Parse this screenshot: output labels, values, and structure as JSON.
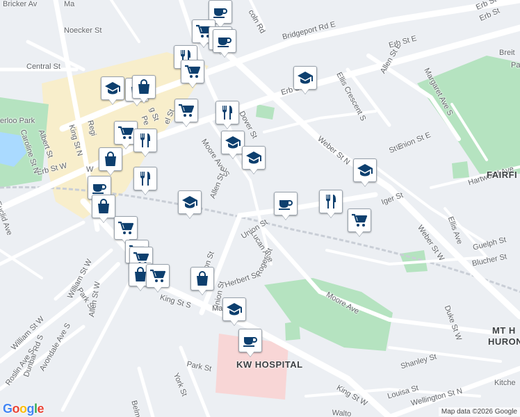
{
  "branding": {
    "logo": [
      "G",
      "o",
      "o",
      "g",
      "l",
      "e"
    ],
    "logo_colors": [
      "#4285F4",
      "#EA4335",
      "#FBBC05",
      "#4285F4",
      "#34A853",
      "#EA4335"
    ],
    "attribution": "Map data ©2026 Google"
  },
  "colors": {
    "road": "#ffffff",
    "background": "#eceff3",
    "park": "#b5e3c0",
    "water": "#aadaff",
    "hospital": "#f8d6d6",
    "downtown": "#fbeec0",
    "rail": "#c9ced6",
    "marker_icon": "#0d3f6e"
  },
  "street_labels": [
    {
      "text": "Bricker Av"
    },
    {
      "text": "Noecker St"
    },
    {
      "text": "Central St"
    },
    {
      "text": "Bridgeport Rd E"
    },
    {
      "text": "Erb St E"
    },
    {
      "text": "Erb St E"
    },
    {
      "text": "Erb St E"
    },
    {
      "text": "Erb St W"
    },
    {
      "text": "erloo Park"
    },
    {
      "text": "Albert St"
    },
    {
      "text": "Caroline St N"
    },
    {
      "text": "King St N"
    },
    {
      "text": "Regi"
    },
    {
      "text": "Pe"
    },
    {
      "text": "Dover St"
    },
    {
      "text": "Moore Ave S"
    },
    {
      "text": "Allen St E"
    },
    {
      "text": "Ellis Crescent S"
    },
    {
      "text": "Allen St E"
    },
    {
      "text": "Margaret Ave S"
    },
    {
      "text": "Weber St N"
    },
    {
      "text": "Union St"
    },
    {
      "text": "Union St"
    },
    {
      "text": "Union St E"
    },
    {
      "text": "Lucan Ave"
    },
    {
      "text": "Hartwood Ave"
    },
    {
      "text": "Ellis Ave"
    },
    {
      "text": "Weber St W"
    },
    {
      "text": "Guelph St"
    },
    {
      "text": "Blucher St"
    },
    {
      "text": "Euclid Ave"
    },
    {
      "text": "William St W"
    },
    {
      "text": "William St W"
    },
    {
      "text": "Park St"
    },
    {
      "text": "Park St"
    },
    {
      "text": "Herbert St"
    },
    {
      "text": "Roger St"
    },
    {
      "text": "Moore Ave"
    },
    {
      "text": "King St S"
    },
    {
      "text": "King St W"
    },
    {
      "text": "Allen St W"
    },
    {
      "text": "Avondale Ave S"
    },
    {
      "text": "Dunbar Rd S"
    },
    {
      "text": "Roslin Ave S"
    },
    {
      "text": "York St"
    },
    {
      "text": "Belm"
    },
    {
      "text": "Duke St W"
    },
    {
      "text": "Shanley St"
    },
    {
      "text": "Louisa St"
    },
    {
      "text": "Wellington St N"
    },
    {
      "text": "Kitche"
    },
    {
      "text": "Walto"
    },
    {
      "text": "Erb St"
    },
    {
      "text": "Iger St"
    },
    {
      "text": "coln Rd"
    },
    {
      "text": "Ma"
    },
    {
      "text": "Union St"
    },
    {
      "text": "St E"
    },
    {
      "text": "Ma"
    },
    {
      "text": "W"
    },
    {
      "text": "g St"
    },
    {
      "text": "el St"
    },
    {
      "text": "Breit"
    },
    {
      "text": "Pa"
    }
  ],
  "area_labels": [
    {
      "text": "FAIRFI"
    },
    {
      "text": "MT H"
    },
    {
      "text": "HURON"
    },
    {
      "text": "KW HOSPITAL"
    }
  ],
  "markers": [
    {
      "type": "coffee"
    },
    {
      "type": "shopping-cart"
    },
    {
      "type": "shopping-cart"
    },
    {
      "type": "coffee"
    },
    {
      "type": "restaurant"
    },
    {
      "type": "shopping-cart"
    },
    {
      "type": "school"
    },
    {
      "type": "shopping-bag"
    },
    {
      "type": "shopping-bag"
    },
    {
      "type": "school"
    },
    {
      "type": "shopping-cart"
    },
    {
      "type": "restaurant"
    },
    {
      "type": "shopping-cart"
    },
    {
      "type": "restaurant"
    },
    {
      "type": "school"
    },
    {
      "type": "school"
    },
    {
      "type": "shopping-bag"
    },
    {
      "type": "restaurant"
    },
    {
      "type": "coffee"
    },
    {
      "type": "shopping-bag"
    },
    {
      "type": "school"
    },
    {
      "type": "school"
    },
    {
      "type": "coffee"
    },
    {
      "type": "restaurant"
    },
    {
      "type": "shopping-cart"
    },
    {
      "type": "shopping-cart"
    },
    {
      "type": "shopping-cart"
    },
    {
      "type": "shopping-cart"
    },
    {
      "type": "shopping-bag"
    },
    {
      "type": "shopping-cart"
    },
    {
      "type": "shopping-bag"
    },
    {
      "type": "school"
    },
    {
      "type": "coffee"
    }
  ]
}
